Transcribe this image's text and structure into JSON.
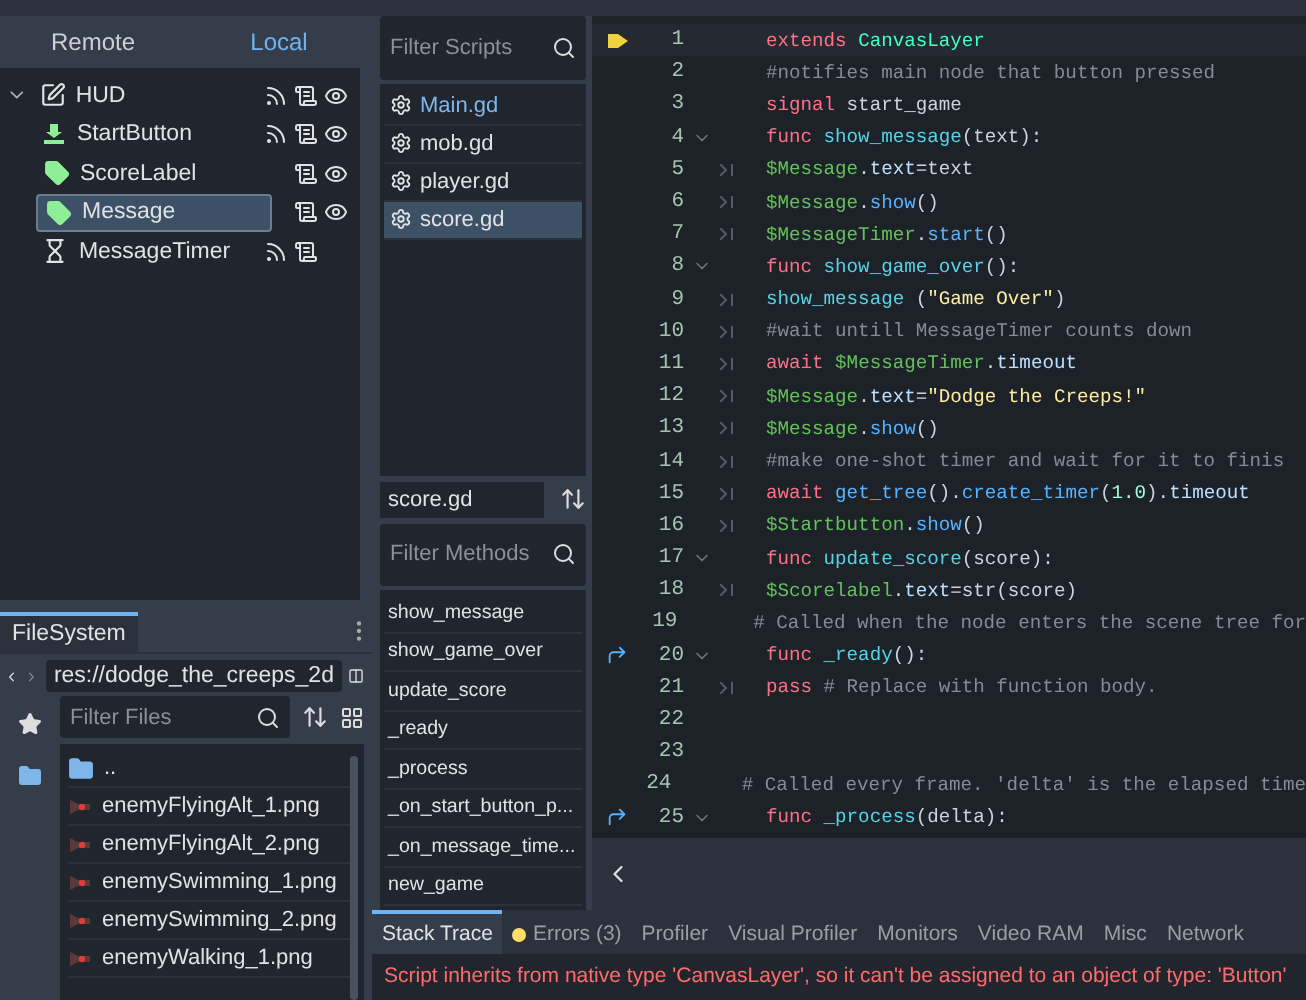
{
  "scene_tabs": [
    {
      "label": "Remote",
      "selected": false
    },
    {
      "label": "Local",
      "selected": true
    }
  ],
  "scene_tree": [
    {
      "name": "HUD",
      "kind": "control",
      "selected": false,
      "signals": true,
      "script": true,
      "visible": true,
      "children": [
        {
          "name": "StartButton",
          "kind": "button",
          "selected": false,
          "signals": true,
          "script": true,
          "visible": true
        },
        {
          "name": "ScoreLabel",
          "kind": "label",
          "selected": false,
          "signals": false,
          "script": true,
          "visible": true
        },
        {
          "name": "Message",
          "kind": "label",
          "selected": true,
          "signals": false,
          "script": true,
          "visible": true
        },
        {
          "name": "MessageTimer",
          "kind": "timer",
          "selected": false,
          "signals": true,
          "script": true,
          "visible": false
        }
      ]
    }
  ],
  "filesystem": {
    "tab": "FileSystem",
    "path": "res://dodge_the_creeps_2d",
    "filter": {
      "placeholder": "Filter Files"
    },
    "files": [
      {
        "name": "..",
        "kind": "folder"
      },
      {
        "name": "enemyFlyingAlt_1.png",
        "kind": "image"
      },
      {
        "name": "enemyFlyingAlt_2.png",
        "kind": "image"
      },
      {
        "name": "enemySwimming_1.png",
        "kind": "image"
      },
      {
        "name": "enemySwimming_2.png",
        "kind": "image"
      },
      {
        "name": "enemyWalking_1.png",
        "kind": "image"
      }
    ]
  },
  "scripts": {
    "filter": {
      "placeholder": "Filter Scripts"
    },
    "items": [
      {
        "name": "Main.gd",
        "active": true,
        "selected": false
      },
      {
        "name": "mob.gd",
        "active": false,
        "selected": false
      },
      {
        "name": "player.gd",
        "active": false,
        "selected": false
      },
      {
        "name": "score.gd",
        "active": false,
        "selected": true
      }
    ]
  },
  "methods": {
    "current_script": "score.gd",
    "filter": {
      "placeholder": "Filter Methods"
    },
    "items": [
      "show_message",
      "show_game_over",
      "update_score",
      "_ready",
      "_process",
      "_on_start_button_p...",
      "_on_message_time...",
      "new_game"
    ]
  },
  "code": [
    {
      "number": "1",
      "current": true,
      "connected": false,
      "fold": false,
      "indented": false,
      "tokens": [
        {
          "kind": "keyword",
          "text": "extends"
        },
        {
          "kind": "type",
          "text": " CanvasLayer"
        }
      ]
    },
    {
      "number": "2",
      "current": false,
      "fold": false,
      "indented": false,
      "tokens": [
        {
          "kind": "comment",
          "text": "#notifies main node that button pressed"
        }
      ]
    },
    {
      "number": "3",
      "current": false,
      "fold": false,
      "indented": false,
      "tokens": [
        {
          "kind": "keyword",
          "text": "signal"
        },
        {
          "kind": "plain",
          "text": " start_game"
        }
      ]
    },
    {
      "number": "4",
      "current": false,
      "fold": true,
      "indented": false,
      "tokens": [
        {
          "kind": "keyword",
          "text": "func"
        },
        {
          "kind": "function",
          "text": " show_message"
        },
        {
          "kind": "plain",
          "text": "(text):"
        }
      ]
    },
    {
      "number": "5",
      "current": false,
      "fold": false,
      "indented": true,
      "tokens": [
        {
          "kind": "node",
          "text": "$Message"
        },
        {
          "kind": "plain",
          "text": "."
        },
        {
          "kind": "member",
          "text": "text"
        },
        {
          "kind": "plain",
          "text": "=text"
        }
      ]
    },
    {
      "number": "6",
      "current": false,
      "fold": false,
      "indented": true,
      "tokens": [
        {
          "kind": "node",
          "text": "$Message"
        },
        {
          "kind": "plain",
          "text": "."
        },
        {
          "kind": "call",
          "text": "show"
        },
        {
          "kind": "plain",
          "text": "()"
        }
      ]
    },
    {
      "number": "7",
      "current": false,
      "fold": false,
      "indented": true,
      "tokens": [
        {
          "kind": "node",
          "text": "$MessageTimer"
        },
        {
          "kind": "plain",
          "text": "."
        },
        {
          "kind": "call",
          "text": "start"
        },
        {
          "kind": "plain",
          "text": "()"
        }
      ]
    },
    {
      "number": "8",
      "current": false,
      "fold": true,
      "indented": false,
      "tokens": [
        {
          "kind": "keyword",
          "text": "func"
        },
        {
          "kind": "function",
          "text": " show_game_over"
        },
        {
          "kind": "plain",
          "text": "():"
        }
      ]
    },
    {
      "number": "9",
      "current": false,
      "fold": false,
      "indented": true,
      "tokens": [
        {
          "kind": "function",
          "text": "show_message"
        },
        {
          "kind": "plain",
          "text": " ("
        },
        {
          "kind": "string",
          "text": "\"Game Over\""
        },
        {
          "kind": "plain",
          "text": ")"
        }
      ]
    },
    {
      "number": "10",
      "current": false,
      "fold": false,
      "indented": true,
      "tokens": [
        {
          "kind": "comment",
          "text": "#wait untill MessageTimer counts down"
        }
      ]
    },
    {
      "number": "11",
      "current": false,
      "fold": false,
      "indented": true,
      "tokens": [
        {
          "kind": "keyword",
          "text": "await"
        },
        {
          "kind": "node",
          "text": " $MessageTimer"
        },
        {
          "kind": "plain",
          "text": "."
        },
        {
          "kind": "member",
          "text": "timeout"
        }
      ]
    },
    {
      "number": "12",
      "current": false,
      "fold": false,
      "indented": true,
      "tokens": [
        {
          "kind": "node",
          "text": "$Message"
        },
        {
          "kind": "plain",
          "text": "."
        },
        {
          "kind": "member",
          "text": "text"
        },
        {
          "kind": "plain",
          "text": "="
        },
        {
          "kind": "string",
          "text": "\"Dodge the Creeps!\""
        }
      ]
    },
    {
      "number": "13",
      "current": false,
      "fold": false,
      "indented": true,
      "tokens": [
        {
          "kind": "node",
          "text": "$Message"
        },
        {
          "kind": "plain",
          "text": "."
        },
        {
          "kind": "call",
          "text": "show"
        },
        {
          "kind": "plain",
          "text": "()"
        }
      ]
    },
    {
      "number": "14",
      "current": false,
      "fold": false,
      "indented": true,
      "tokens": [
        {
          "kind": "comment",
          "text": "#make one-shot timer and wait for it to finis"
        }
      ]
    },
    {
      "number": "15",
      "current": false,
      "fold": false,
      "indented": true,
      "tokens": [
        {
          "kind": "keyword",
          "text": "await"
        },
        {
          "kind": "call",
          "text": " get_tree"
        },
        {
          "kind": "plain",
          "text": "()."
        },
        {
          "kind": "call",
          "text": "create_timer"
        },
        {
          "kind": "plain",
          "text": "("
        },
        {
          "kind": "number",
          "text": "1.0"
        },
        {
          "kind": "plain",
          "text": ")."
        },
        {
          "kind": "member",
          "text": "timeout"
        }
      ]
    },
    {
      "number": "16",
      "current": false,
      "fold": false,
      "indented": true,
      "tokens": [
        {
          "kind": "node",
          "text": "$Startbutton"
        },
        {
          "kind": "plain",
          "text": "."
        },
        {
          "kind": "call",
          "text": "show"
        },
        {
          "kind": "plain",
          "text": "()"
        }
      ]
    },
    {
      "number": "17",
      "current": false,
      "fold": true,
      "indented": false,
      "tokens": [
        {
          "kind": "keyword",
          "text": "func"
        },
        {
          "kind": "function",
          "text": " update_score"
        },
        {
          "kind": "plain",
          "text": "(score):"
        }
      ]
    },
    {
      "number": "18",
      "current": false,
      "fold": false,
      "indented": true,
      "tokens": [
        {
          "kind": "node",
          "text": "$Scorelabel"
        },
        {
          "kind": "plain",
          "text": "."
        },
        {
          "kind": "member",
          "text": "text"
        },
        {
          "kind": "plain",
          "text": "=str(score)"
        }
      ]
    },
    {
      "number": "19",
      "current": false,
      "fold": false,
      "indented": false,
      "tokens": [
        {
          "kind": "comment",
          "text": "# Called when the node enters the scene tree for"
        }
      ]
    },
    {
      "number": "20",
      "current": false,
      "connected": true,
      "fold": true,
      "indented": false,
      "tokens": [
        {
          "kind": "keyword",
          "text": "func"
        },
        {
          "kind": "function",
          "text": " _ready"
        },
        {
          "kind": "plain",
          "text": "():"
        }
      ]
    },
    {
      "number": "21",
      "current": false,
      "fold": false,
      "indented": true,
      "tokens": [
        {
          "kind": "keyword",
          "text": "pass"
        },
        {
          "kind": "comment",
          "text": " # Replace with function body."
        }
      ]
    },
    {
      "number": "22",
      "current": false,
      "fold": false,
      "indented": false
    },
    {
      "number": "23",
      "current": false,
      "fold": false,
      "indented": false
    },
    {
      "number": "24",
      "current": false,
      "fold": false,
      "indented": false,
      "tokens": [
        {
          "kind": "comment",
          "text": "# Called every frame. 'delta' is the elapsed time"
        }
      ]
    },
    {
      "number": "25",
      "current": false,
      "connected": true,
      "fold": true,
      "indented": false,
      "tokens": [
        {
          "kind": "keyword",
          "text": "func"
        },
        {
          "kind": "function",
          "text": " _process"
        },
        {
          "kind": "plain",
          "text": "(delta):"
        }
      ]
    }
  ],
  "bottom_tabs": [
    {
      "label": "Stack Trace",
      "selected": true,
      "alert": false
    },
    {
      "label": "Errors (3)",
      "selected": false,
      "alert": true
    },
    {
      "label": "Profiler",
      "selected": false,
      "alert": false
    },
    {
      "label": "Visual Profiler",
      "selected": false,
      "alert": false
    },
    {
      "label": "Monitors",
      "selected": false,
      "alert": false
    },
    {
      "label": "Video RAM",
      "selected": false,
      "alert": false
    },
    {
      "label": "Misc",
      "selected": false,
      "alert": false
    },
    {
      "label": "Network",
      "selected": false,
      "alert": false
    }
  ],
  "error_message": "Script inherits from native type 'CanvasLayer', so it can't be assigned to an object of type: 'Button'"
}
